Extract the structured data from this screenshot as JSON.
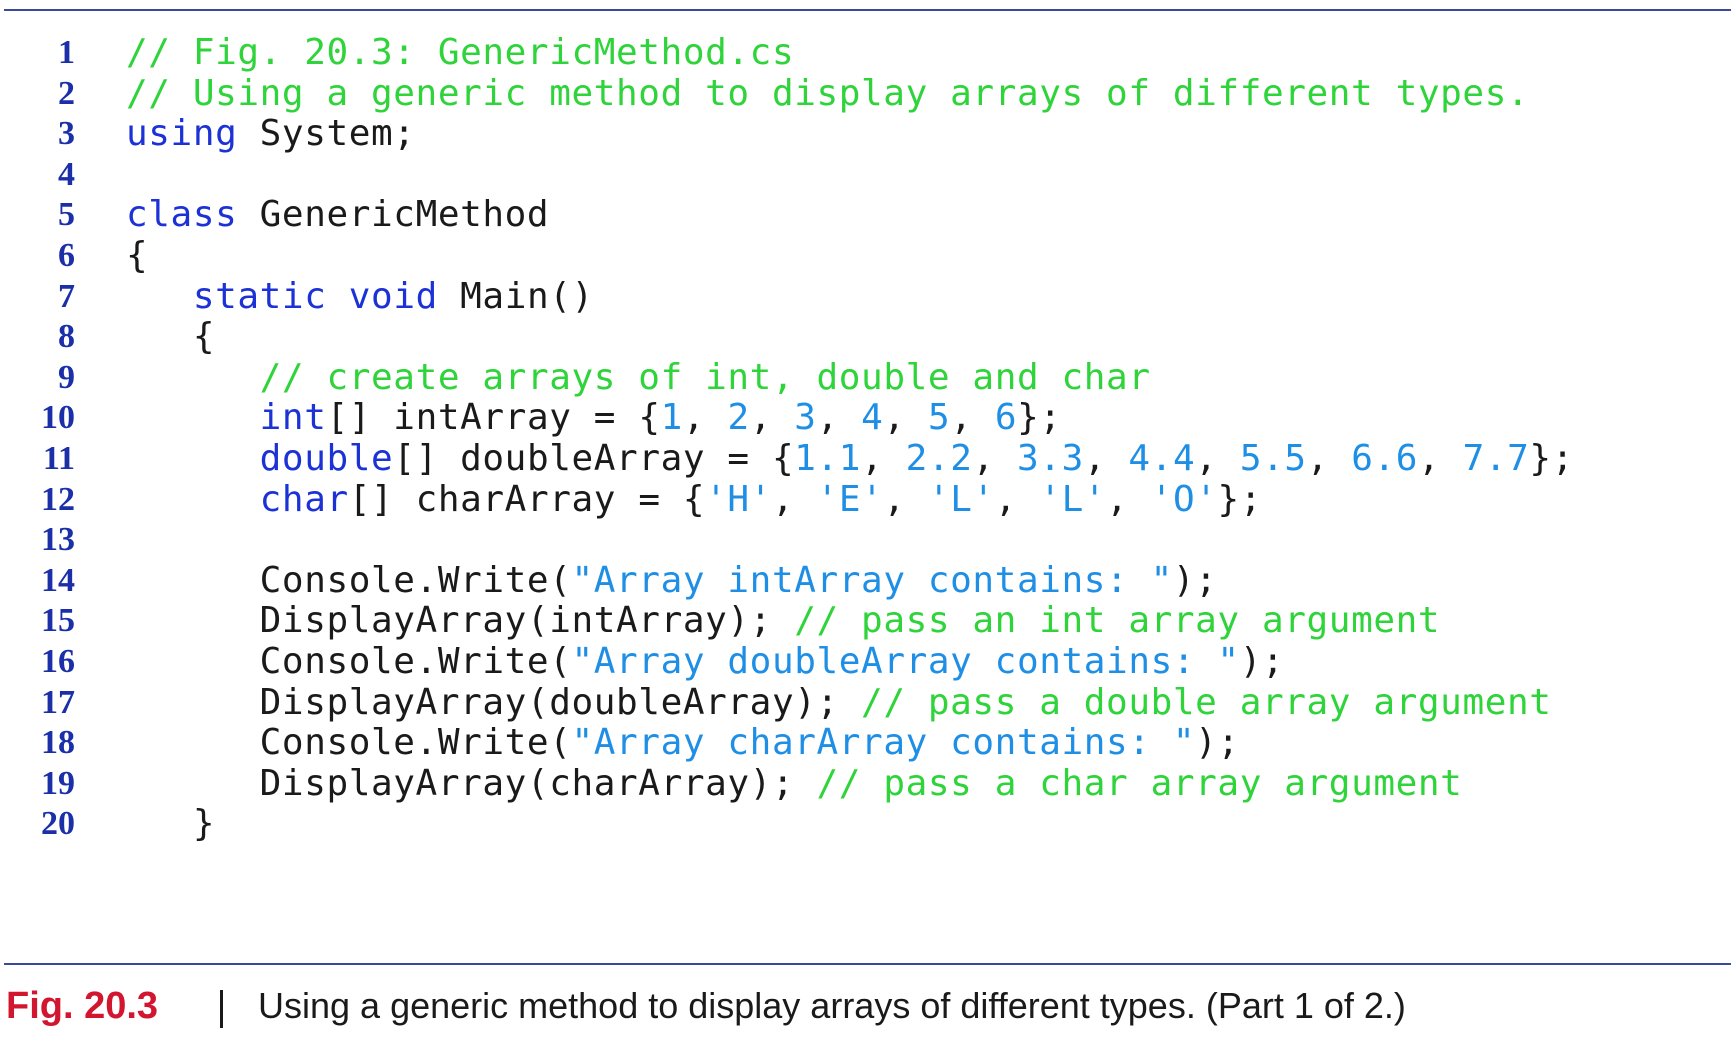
{
  "code": {
    "lines": [
      {
        "num": "1",
        "tokens": [
          {
            "t": "// Fig. 20.3: GenericMethod.cs",
            "k": "comment"
          }
        ]
      },
      {
        "num": "2",
        "tokens": [
          {
            "t": "// Using a generic method to display arrays of different types.",
            "k": "comment"
          }
        ]
      },
      {
        "num": "3",
        "tokens": [
          {
            "t": "using",
            "k": "keyword"
          },
          {
            "t": " System;",
            "k": "plain"
          }
        ]
      },
      {
        "num": "4",
        "tokens": []
      },
      {
        "num": "5",
        "tokens": [
          {
            "t": "class",
            "k": "keyword"
          },
          {
            "t": " GenericMethod",
            "k": "plain"
          }
        ]
      },
      {
        "num": "6",
        "tokens": [
          {
            "t": "{",
            "k": "plain"
          }
        ]
      },
      {
        "num": "7",
        "tokens": [
          {
            "t": "   ",
            "k": "plain"
          },
          {
            "t": "static",
            "k": "keyword"
          },
          {
            "t": " ",
            "k": "plain"
          },
          {
            "t": "void",
            "k": "keyword"
          },
          {
            "t": " Main()",
            "k": "plain"
          }
        ]
      },
      {
        "num": "8",
        "tokens": [
          {
            "t": "   {",
            "k": "plain"
          }
        ]
      },
      {
        "num": "9",
        "tokens": [
          {
            "t": "      ",
            "k": "plain"
          },
          {
            "t": "// create arrays of int, double and char",
            "k": "comment"
          }
        ]
      },
      {
        "num": "10",
        "tokens": [
          {
            "t": "      ",
            "k": "plain"
          },
          {
            "t": "int",
            "k": "keyword"
          },
          {
            "t": "[] intArray = {",
            "k": "plain"
          },
          {
            "t": "1",
            "k": "literal"
          },
          {
            "t": ", ",
            "k": "plain"
          },
          {
            "t": "2",
            "k": "literal"
          },
          {
            "t": ", ",
            "k": "plain"
          },
          {
            "t": "3",
            "k": "literal"
          },
          {
            "t": ", ",
            "k": "plain"
          },
          {
            "t": "4",
            "k": "literal"
          },
          {
            "t": ", ",
            "k": "plain"
          },
          {
            "t": "5",
            "k": "literal"
          },
          {
            "t": ", ",
            "k": "plain"
          },
          {
            "t": "6",
            "k": "literal"
          },
          {
            "t": "};",
            "k": "plain"
          }
        ]
      },
      {
        "num": "11",
        "tokens": [
          {
            "t": "      ",
            "k": "plain"
          },
          {
            "t": "double",
            "k": "keyword"
          },
          {
            "t": "[] doubleArray = {",
            "k": "plain"
          },
          {
            "t": "1.1",
            "k": "literal"
          },
          {
            "t": ", ",
            "k": "plain"
          },
          {
            "t": "2.2",
            "k": "literal"
          },
          {
            "t": ", ",
            "k": "plain"
          },
          {
            "t": "3.3",
            "k": "literal"
          },
          {
            "t": ", ",
            "k": "plain"
          },
          {
            "t": "4.4",
            "k": "literal"
          },
          {
            "t": ", ",
            "k": "plain"
          },
          {
            "t": "5.5",
            "k": "literal"
          },
          {
            "t": ", ",
            "k": "plain"
          },
          {
            "t": "6.6",
            "k": "literal"
          },
          {
            "t": ", ",
            "k": "plain"
          },
          {
            "t": "7.7",
            "k": "literal"
          },
          {
            "t": "};",
            "k": "plain"
          }
        ]
      },
      {
        "num": "12",
        "tokens": [
          {
            "t": "      ",
            "k": "plain"
          },
          {
            "t": "char",
            "k": "keyword"
          },
          {
            "t": "[] charArray = {",
            "k": "plain"
          },
          {
            "t": "'H'",
            "k": "literal"
          },
          {
            "t": ", ",
            "k": "plain"
          },
          {
            "t": "'E'",
            "k": "literal"
          },
          {
            "t": ", ",
            "k": "plain"
          },
          {
            "t": "'L'",
            "k": "literal"
          },
          {
            "t": ", ",
            "k": "plain"
          },
          {
            "t": "'L'",
            "k": "literal"
          },
          {
            "t": ", ",
            "k": "plain"
          },
          {
            "t": "'O'",
            "k": "literal"
          },
          {
            "t": "};",
            "k": "plain"
          }
        ]
      },
      {
        "num": "13",
        "tokens": []
      },
      {
        "num": "14",
        "tokens": [
          {
            "t": "      Console.Write(",
            "k": "plain"
          },
          {
            "t": "\"Array intArray contains: \"",
            "k": "literal"
          },
          {
            "t": ");",
            "k": "plain"
          }
        ]
      },
      {
        "num": "15",
        "tokens": [
          {
            "t": "      DisplayArray(intArray); ",
            "k": "plain"
          },
          {
            "t": "// pass an int array argument",
            "k": "comment"
          }
        ]
      },
      {
        "num": "16",
        "tokens": [
          {
            "t": "      Console.Write(",
            "k": "plain"
          },
          {
            "t": "\"Array doubleArray contains: \"",
            "k": "literal"
          },
          {
            "t": ");",
            "k": "plain"
          }
        ]
      },
      {
        "num": "17",
        "tokens": [
          {
            "t": "      DisplayArray(doubleArray); ",
            "k": "plain"
          },
          {
            "t": "// pass a double array argument",
            "k": "comment"
          }
        ]
      },
      {
        "num": "18",
        "tokens": [
          {
            "t": "      Console.Write(",
            "k": "plain"
          },
          {
            "t": "\"Array charArray contains: \"",
            "k": "literal"
          },
          {
            "t": ");",
            "k": "plain"
          }
        ]
      },
      {
        "num": "19",
        "tokens": [
          {
            "t": "      DisplayArray(charArray); ",
            "k": "plain"
          },
          {
            "t": "// pass a char array argument",
            "k": "comment"
          }
        ]
      },
      {
        "num": "20",
        "tokens": [
          {
            "t": "   }",
            "k": "plain"
          }
        ]
      }
    ]
  },
  "caption": {
    "label": "Fig. 20.3",
    "text": "Using a generic method to display arrays of different types. (Part 1 of 2.)"
  },
  "colors": {
    "comment": "#2fd33a",
    "keyword": "#1c32d6",
    "literal": "#1f8fe6",
    "plain": "#1a1a1a",
    "line_number": "#1a2fa8",
    "caption_label": "#d2162f",
    "rule": "#3a4a9a"
  }
}
